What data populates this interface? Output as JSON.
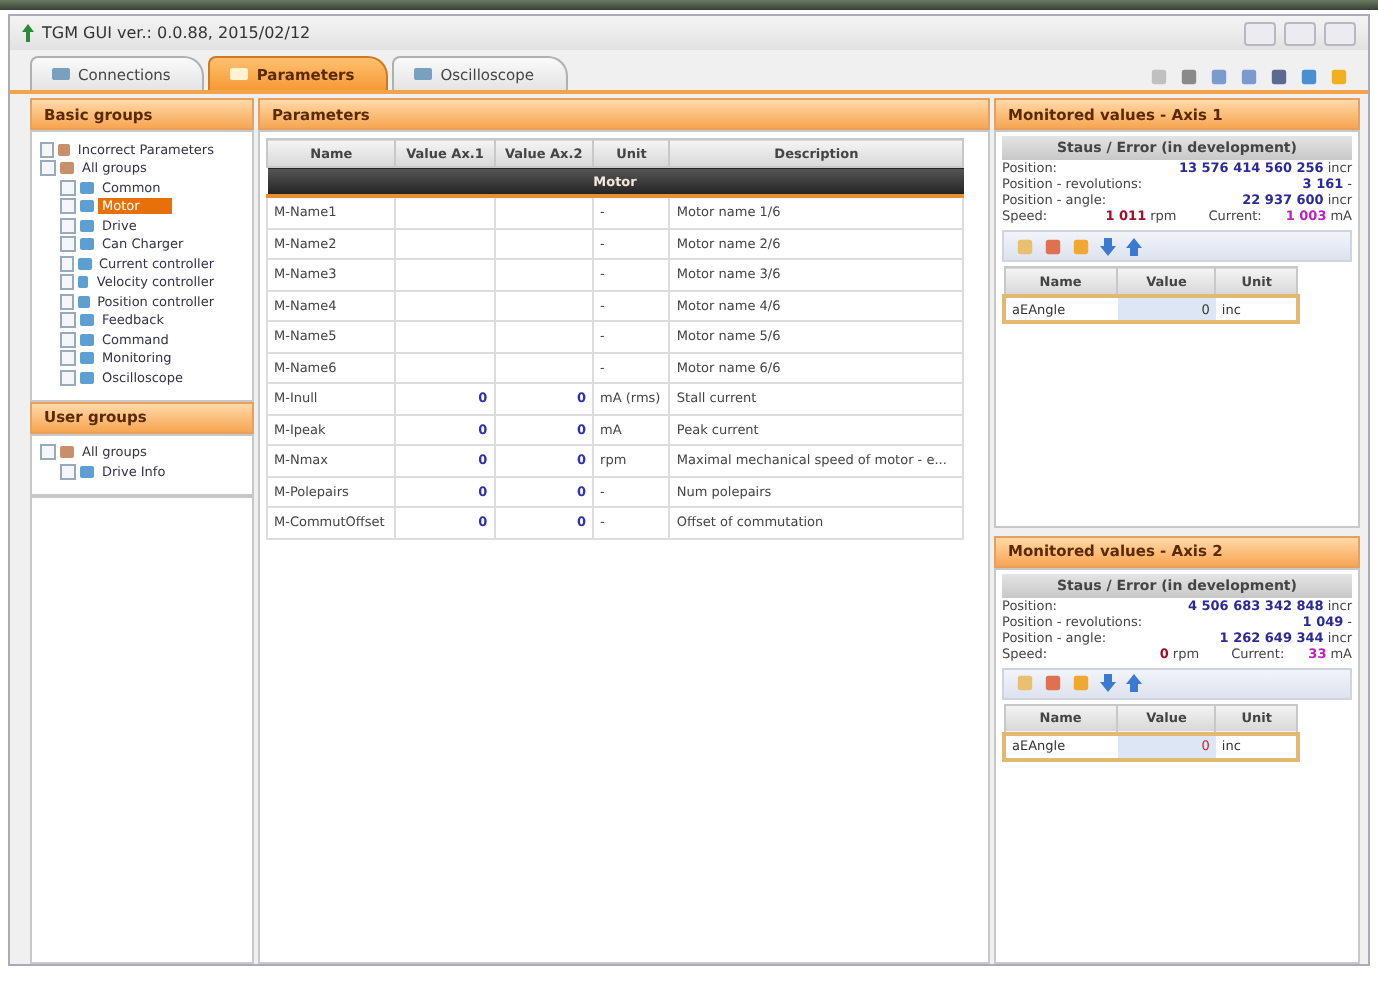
{
  "window": {
    "title": "TGM GUI  ver.: 0.0.88,  2015/02/12"
  },
  "tabs": [
    {
      "label": "Connections",
      "selected": false
    },
    {
      "label": "Parameters",
      "selected": true
    },
    {
      "label": "Oscilloscope",
      "selected": false
    }
  ],
  "sidebar": {
    "sections": [
      {
        "title": "Basic groups",
        "items": [
          {
            "label": "Incorrect Parameters",
            "checked": false,
            "selected": false
          },
          {
            "label": "All groups",
            "checked": false,
            "selected": false,
            "children": [
              {
                "label": "Common",
                "checked": false,
                "selected": false
              },
              {
                "label": "Motor",
                "checked": false,
                "selected": true
              },
              {
                "label": "Drive",
                "checked": false,
                "selected": false
              },
              {
                "label": "Can Charger",
                "checked": false,
                "selected": false
              },
              {
                "label": "Current controller",
                "checked": false,
                "selected": false
              },
              {
                "label": "Velocity controller",
                "checked": false,
                "selected": false
              },
              {
                "label": "Position controller",
                "checked": false,
                "selected": false
              },
              {
                "label": "Feedback",
                "checked": false,
                "selected": false
              },
              {
                "label": "Command",
                "checked": false,
                "selected": false
              },
              {
                "label": "Monitoring",
                "checked": false,
                "selected": false
              },
              {
                "label": "Oscilloscope",
                "checked": false,
                "selected": false
              }
            ]
          }
        ]
      },
      {
        "title": "User groups",
        "items": [
          {
            "label": "All groups",
            "checked": false,
            "selected": false,
            "children": [
              {
                "label": "Drive Info",
                "checked": false,
                "selected": false
              }
            ]
          }
        ]
      }
    ]
  },
  "parameters": {
    "title": "Parameters",
    "columns": [
      "Name",
      "Value Ax.1",
      "Value Ax.2",
      "Unit",
      "Description"
    ],
    "group": "Motor",
    "rows": [
      [
        "M-Name1",
        "",
        "",
        "-",
        "Motor name 1/6"
      ],
      [
        "M-Name2",
        "",
        "",
        "-",
        "Motor name 2/6"
      ],
      [
        "M-Name3",
        "",
        "",
        "-",
        "Motor name 3/6"
      ],
      [
        "M-Name4",
        "",
        "",
        "-",
        "Motor name 4/6"
      ],
      [
        "M-Name5",
        "",
        "",
        "-",
        "Motor name 5/6"
      ],
      [
        "M-Name6",
        "",
        "",
        "-",
        "Motor name 6/6"
      ],
      [
        "M-Inull",
        "0",
        "0",
        "mA (rms)",
        "Stall current"
      ],
      [
        "M-Ipeak",
        "0",
        "0",
        "mA",
        "Peak current"
      ],
      [
        "M-Nmax",
        "0",
        "0",
        "rpm",
        "Maximal mechanical speed of motor - e..."
      ],
      [
        "M-Polepairs",
        "0",
        "0",
        "-",
        "Num polepairs"
      ],
      [
        "M-CommutOffset",
        "0",
        "0",
        "-",
        "Offset of commutation"
      ]
    ]
  },
  "monitors": [
    {
      "title": "Monitored values - Axis 1",
      "status": "Staus / Error  (in development)",
      "position_label": "Position:",
      "position": "13 576 414 560 256",
      "position_unit": "incr",
      "revolutions_label": "Position - revolutions:",
      "revolutions": "3 161",
      "revolutions_unit": "-",
      "angle_label": "Position - angle:",
      "angle": "22 937 600",
      "angle_unit": "incr",
      "speed_label": "Speed:",
      "speed": "1 011",
      "speed_unit": "rpm",
      "current_label": "Current:",
      "current": "1 003",
      "current_unit": "mA",
      "columns": [
        "Name",
        "Value",
        "Unit"
      ],
      "rows": [
        {
          "name": "aEAngle",
          "value": "0",
          "unit": "inc",
          "alert": false
        }
      ]
    },
    {
      "title": "Monitored values - Axis 2",
      "status": "Staus / Error  (in development)",
      "position_label": "Position:",
      "position": "4 506 683 342 848",
      "position_unit": "incr",
      "revolutions_label": "Position - revolutions:",
      "revolutions": "1 049",
      "revolutions_unit": "-",
      "angle_label": "Position - angle:",
      "angle": "1 262 649 344",
      "angle_unit": "incr",
      "speed_label": "Speed:",
      "speed": "0",
      "speed_unit": "rpm",
      "current_label": "Current:",
      "current": "33",
      "current_unit": "mA",
      "columns": [
        "Name",
        "Value",
        "Unit"
      ],
      "rows": [
        {
          "name": "aEAngle",
          "value": "0",
          "unit": "inc",
          "alert": true
        }
      ]
    }
  ]
}
